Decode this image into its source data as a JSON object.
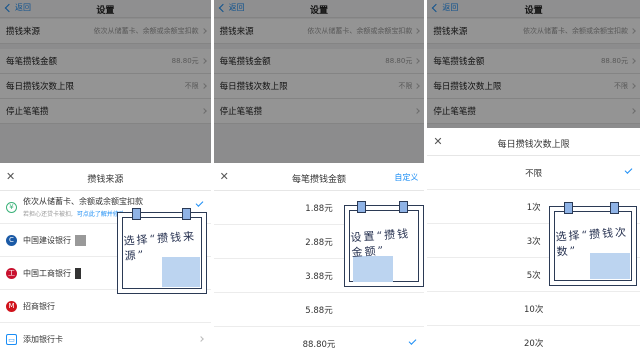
{
  "nav": {
    "back_label": "返回",
    "title": "设置"
  },
  "settings_rows": [
    {
      "label": "攒钱来源",
      "value": "依次从储蓄卡、余额或余额宝扣款"
    },
    {
      "label": "每笔攒钱金额",
      "value": "88.80元"
    },
    {
      "label": "每日攒钱次数上限",
      "value": "不限"
    },
    {
      "label": "停止笔笔攒",
      "value": ""
    }
  ],
  "panel1": {
    "sheet_title": "攒钱来源",
    "sources": [
      {
        "icon": "yuan-icon",
        "label": "依次从储蓄卡、余额或余额宝扣款",
        "sub": "若担心还贷卡被扣,",
        "sub_link": "可点此了解并修改 >"
      },
      {
        "icon": "ccb-icon",
        "label": "中国建设银行"
      },
      {
        "icon": "icbc-icon",
        "label": "中国工商银行"
      },
      {
        "icon": "cmb-icon",
        "label": "招商银行"
      },
      {
        "icon": "add-card-icon",
        "label": "添加银行卡"
      }
    ],
    "note": "选择“攒钱来源”"
  },
  "panel2": {
    "sheet_title": "每笔攒钱金额",
    "custom_label": "自定义",
    "options": [
      "1.88元",
      "2.88元",
      "3.88元",
      "5.88元",
      "88.80元"
    ],
    "selected": "88.80元",
    "note": "设置“攒钱金额”"
  },
  "panel3": {
    "sheet_title": "每日攒钱次数上限",
    "options": [
      "不限",
      "1次",
      "3次",
      "5次",
      "10次",
      "20次"
    ],
    "selected": "不限",
    "note": "选择“攒钱次数”"
  },
  "colors": {
    "accent": "#1a8df5",
    "overlay": "rgba(0,0,0,0.42)",
    "note_blue": "#bcd4f0",
    "note_ink": "#263150"
  }
}
